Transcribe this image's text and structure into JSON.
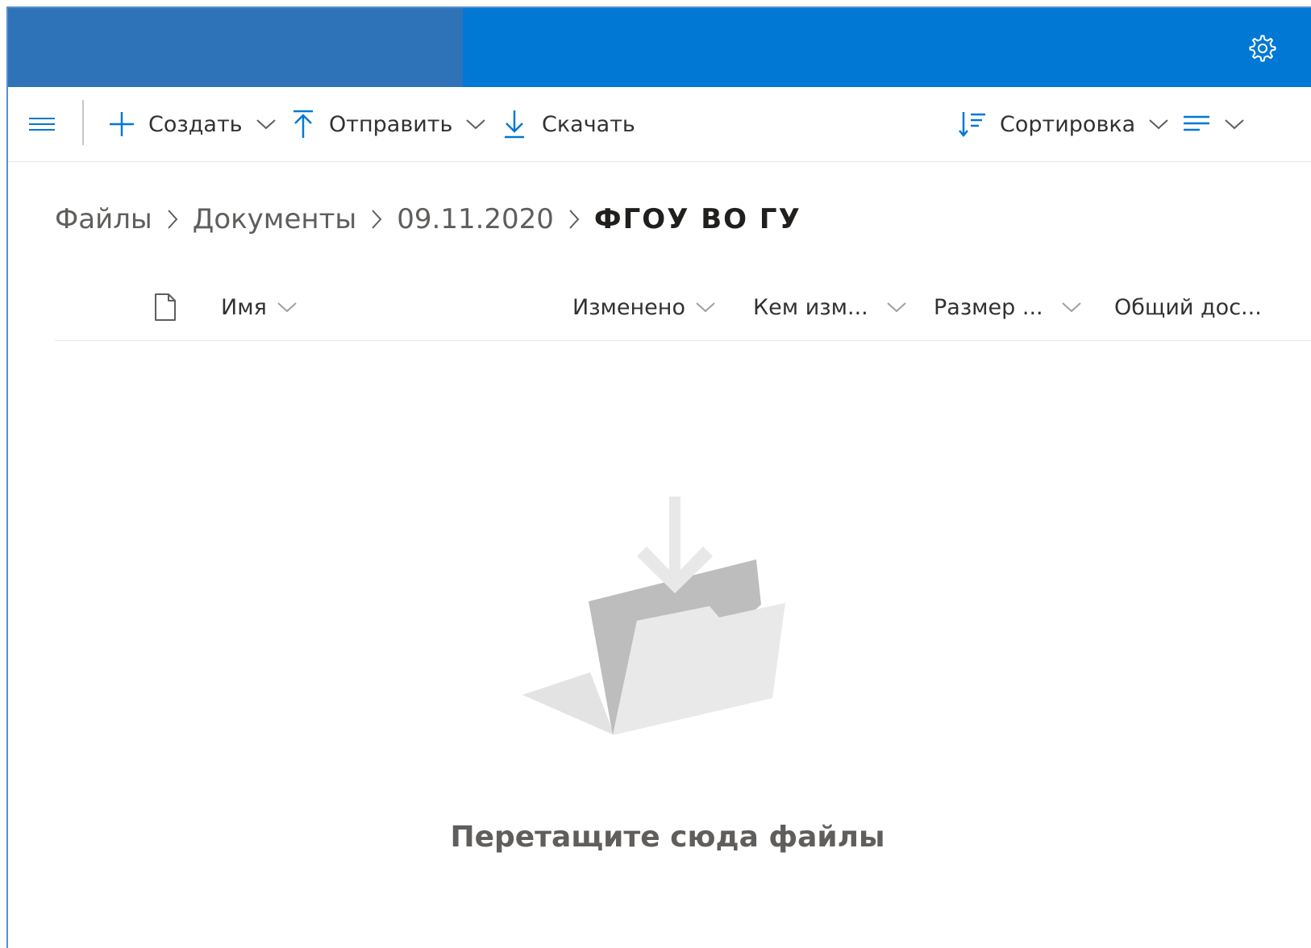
{
  "header": {
    "settings_icon": "gear-icon",
    "brand_color": "#0078d4",
    "left_block_color": "#2e73b8"
  },
  "toolbar": {
    "menu_icon": "hamburger-icon",
    "create_label": "Создать",
    "upload_label": "Отправить",
    "download_label": "Скачать",
    "sort_label": "Сортировка",
    "view_icon": "view-options-icon",
    "accent_color": "#0078d4"
  },
  "breadcrumb": {
    "items": [
      "Файлы",
      "Документы",
      "09.11.2020"
    ],
    "current": "ФГОУ ВО ГУ"
  },
  "columns": {
    "type_icon": "file-icon",
    "name": "Имя",
    "modified": "Изменено",
    "modified_by": "Кем изм...",
    "size": "Размер ...",
    "sharing": "Общий дос..."
  },
  "empty_state": {
    "illustration": "folder-drop-icon",
    "message": "Перетащите сюда файлы"
  }
}
